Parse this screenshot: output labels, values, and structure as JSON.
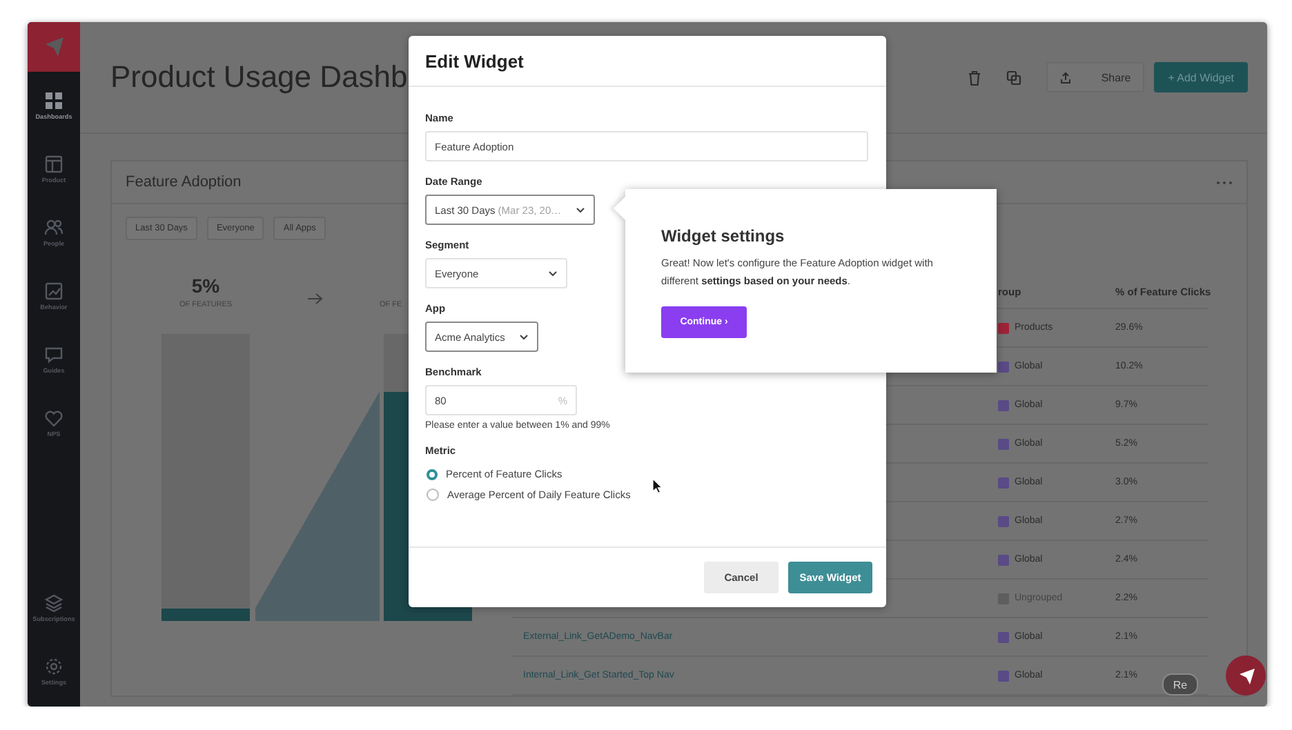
{
  "sidebar": {
    "items": [
      {
        "label": "Dashboards",
        "selected": true
      },
      {
        "label": "Product",
        "selected": false
      },
      {
        "label": "People",
        "selected": false
      },
      {
        "label": "Behavior",
        "selected": false
      },
      {
        "label": "Guides",
        "selected": false
      },
      {
        "label": "NPS",
        "selected": false
      }
    ],
    "bottom_items": [
      {
        "label": "Subscriptions",
        "selected": false
      },
      {
        "label": "Settings",
        "selected": false
      }
    ]
  },
  "header": {
    "title": "Product Usage Dashb",
    "share_button": "Share",
    "add_button": "+ Add Widget"
  },
  "widget": {
    "title": "Feature Adoption",
    "filters": [
      "Last 30 Days",
      "Everyone",
      "All Apps"
    ],
    "stats": [
      {
        "value": "5%",
        "caption": "OF FEATURES"
      },
      {
        "caption": "OF FE"
      }
    ],
    "bars": [
      {
        "level": 0.045
      },
      {
        "level": 0.8
      }
    ],
    "table": {
      "columns": [
        "",
        "roup",
        "% of Feature Clicks"
      ],
      "rows": [
        {
          "feature": "",
          "group": "Products",
          "color": "#9e2438",
          "grouped": true,
          "share": "29.6%"
        },
        {
          "feature": "",
          "group": "Global",
          "color": "#5a4a86",
          "grouped": true,
          "share": "10.2%"
        },
        {
          "feature": "",
          "group": "Global",
          "color": "#5a4a86",
          "grouped": true,
          "share": "9.7%"
        },
        {
          "feature": "",
          "group": "Global",
          "color": "#5a4a86",
          "grouped": true,
          "share": "5.2%"
        },
        {
          "feature": "",
          "group": "Global",
          "color": "#5a4a86",
          "grouped": true,
          "share": "3.0%"
        },
        {
          "feature": "",
          "group": "Global",
          "color": "#5a4a86",
          "grouped": true,
          "share": "2.7%"
        },
        {
          "feature": "",
          "group": "Global",
          "color": "#5a4a86",
          "grouped": true,
          "share": "2.4%"
        },
        {
          "feature": "",
          "group": "Ungrouped",
          "color": "#5e5e5e",
          "grouped": false,
          "share": "2.2%"
        },
        {
          "feature": "External_Link_GetADemo_NavBar",
          "group": "Global",
          "color": "#5a4a86",
          "grouped": true,
          "share": "2.1%"
        },
        {
          "feature": "Internal_Link_Get Started_Top Nav",
          "group": "Global",
          "color": "#5a4a86",
          "grouped": true,
          "share": "2.1%"
        }
      ]
    }
  },
  "modal": {
    "title": "Edit Widget",
    "fields": [
      {
        "kind": "text",
        "label": "Name",
        "value": "Feature Adoption"
      },
      {
        "kind": "select",
        "label": "Date Range",
        "value": "Last 30 Days",
        "detail": "(Mar 23, 20…",
        "focused": true
      },
      {
        "kind": "select",
        "label": "Segment",
        "value": "Everyone",
        "focused": false
      },
      {
        "kind": "select",
        "label": "App",
        "value": "Acme Analytics",
        "focused": true
      },
      {
        "kind": "number",
        "label": "Benchmark",
        "value": "80",
        "suffix": "%",
        "hint": "Please enter a value between 1% and 99%"
      },
      {
        "kind": "radio",
        "label": "Metric",
        "options": [
          {
            "label": "Percent of Feature Clicks",
            "selected": true
          },
          {
            "label": "Average Percent of Daily Feature Clicks",
            "selected": false
          }
        ]
      }
    ],
    "cancel_button": "Cancel",
    "save_button": "Save Widget"
  },
  "popover": {
    "title": "Widget settings",
    "text": "Great! Now let's configure the Feature Adoption widget with different **settings based on your needs**.",
    "button": "Continue ›"
  },
  "help_badge": "Re"
}
